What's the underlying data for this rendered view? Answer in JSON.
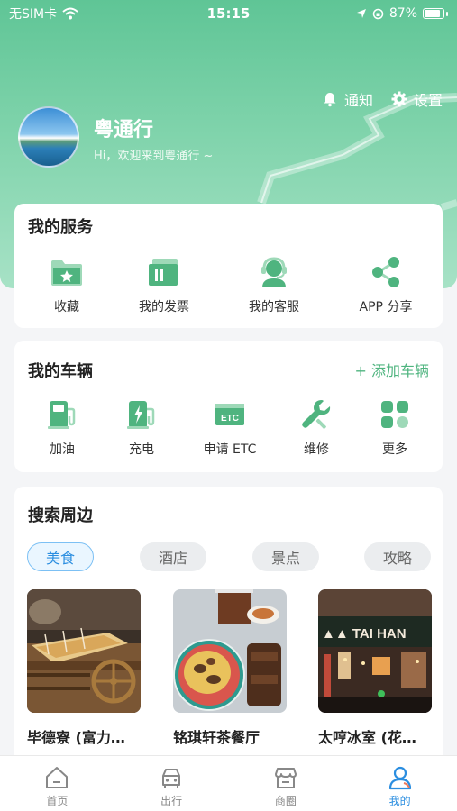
{
  "status_bar": {
    "carrier": "无SIM卡",
    "time": "15:15",
    "battery": "87%"
  },
  "header": {
    "notify_label": "通知",
    "settings_label": "设置",
    "app_name": "粤通行",
    "welcome": "Hi，欢迎来到粤通行 ~"
  },
  "services": {
    "title": "我的服务",
    "items": [
      {
        "label": "收藏",
        "icon": "favorites-folder-icon"
      },
      {
        "label": "我的发票",
        "icon": "invoice-icon"
      },
      {
        "label": "我的客服",
        "icon": "customer-service-icon"
      },
      {
        "label": "APP 分享",
        "icon": "share-icon"
      }
    ]
  },
  "vehicles": {
    "title": "我的车辆",
    "add_label": "+ 添加车辆",
    "items": [
      {
        "label": "加油",
        "icon": "fuel-pump-icon"
      },
      {
        "label": "充电",
        "icon": "ev-charger-icon"
      },
      {
        "label": "申请 ETC",
        "icon": "etc-card-icon"
      },
      {
        "label": "维修",
        "icon": "wrench-icon"
      },
      {
        "label": "更多",
        "icon": "grid-more-icon"
      }
    ]
  },
  "nearby": {
    "title": "搜索周边",
    "tabs": [
      "美食",
      "酒店",
      "景点",
      "攻略"
    ],
    "active_tab": "美食",
    "places": [
      {
        "name": "毕德寮 (富力…"
      },
      {
        "name": "铭琪轩茶餐厅"
      },
      {
        "name": "太哼冰室 (花…"
      }
    ]
  },
  "tabbar": {
    "items": [
      {
        "label": "首页",
        "icon": "home-icon"
      },
      {
        "label": "出行",
        "icon": "car-icon"
      },
      {
        "label": "商圈",
        "icon": "store-icon"
      },
      {
        "label": "我的",
        "icon": "profile-icon"
      }
    ],
    "active": "我的"
  },
  "colors": {
    "brand_green": "#4fb47f",
    "active_blue": "#2b8ee0"
  }
}
